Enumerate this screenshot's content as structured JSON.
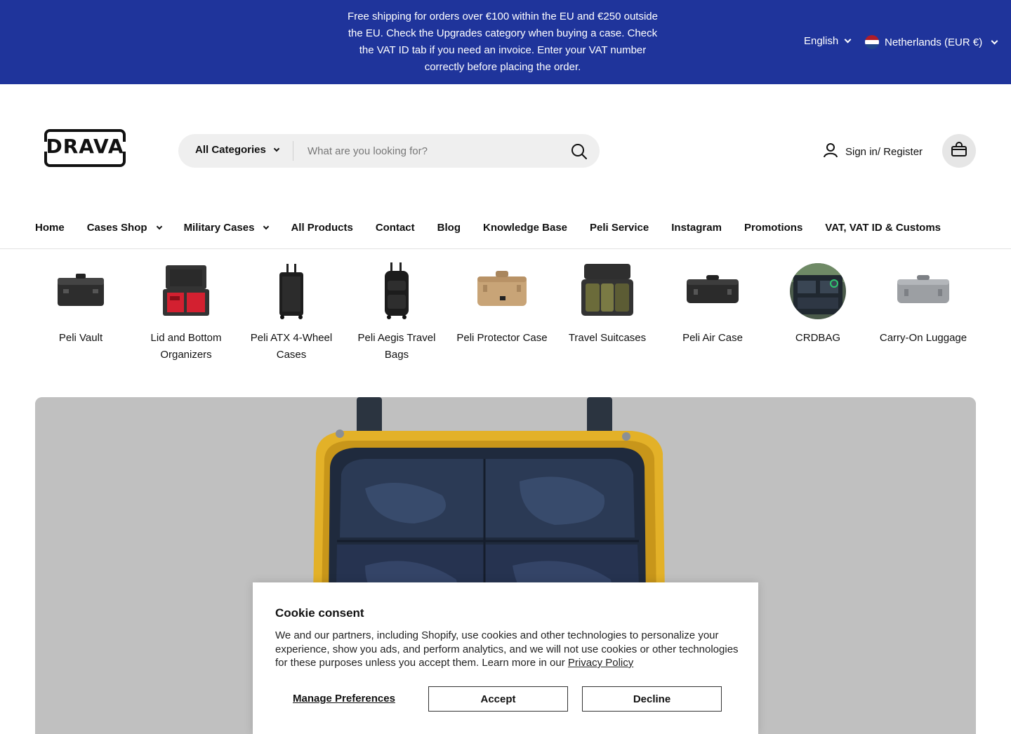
{
  "announcement": {
    "text": "Free shipping for orders over €100 within the EU and €250 outside the EU. Check the Upgrades category when buying a case. Check the VAT ID tab if you need an invoice. Enter your VAT number correctly before placing the order.",
    "language": "English",
    "country": "Netherlands (EUR €)"
  },
  "header": {
    "logo_text": "DRAVA",
    "search_category": "All Categories",
    "search_placeholder": "What are you looking for?",
    "signin_label": "Sign in/ Register"
  },
  "nav": {
    "items": [
      {
        "label": "Home"
      },
      {
        "label": "Cases Shop",
        "dropdown": true
      },
      {
        "label": "Military Cases",
        "dropdown": true
      },
      {
        "label": "All Products"
      },
      {
        "label": "Contact"
      },
      {
        "label": "Blog"
      },
      {
        "label": "Knowledge Base"
      },
      {
        "label": "Peli Service"
      },
      {
        "label": "Instagram"
      },
      {
        "label": "Promotions"
      },
      {
        "label": "VAT, VAT ID & Customs"
      }
    ]
  },
  "categories": [
    {
      "label": "Peli Vault"
    },
    {
      "label": "Lid and Bottom Organizers"
    },
    {
      "label": "Peli ATX 4-Wheel Cases"
    },
    {
      "label": "Peli Aegis Travel Bags"
    },
    {
      "label": "Peli Protector Case"
    },
    {
      "label": "Travel Suitcases"
    },
    {
      "label": "Peli Air Case"
    },
    {
      "label": "CRDBAG"
    },
    {
      "label": "Carry-On Luggage"
    }
  ],
  "cookie": {
    "title": "Cookie consent",
    "body": "We and our partners, including Shopify, use cookies and other technologies to personalize your experience, show you ads, and perform analytics, and we will not use cookies or other technologies for these purposes unless you accept them. Learn more in our ",
    "privacy_link": "Privacy Policy",
    "manage_label": "Manage Preferences",
    "accept_label": "Accept",
    "decline_label": "Decline"
  },
  "colors": {
    "topbar": "#1f349b",
    "hero_bg": "#c0c0c0",
    "case_yellow": "#e8b61d"
  }
}
